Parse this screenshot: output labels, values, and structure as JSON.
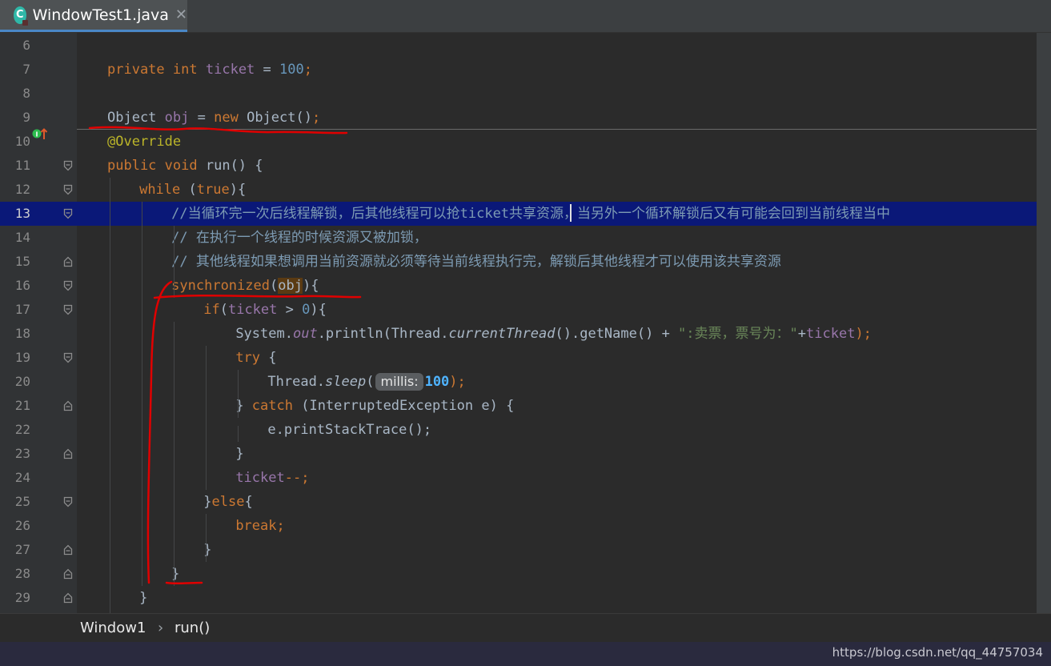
{
  "tab": {
    "file_name": "WindowTest1.java",
    "icon": "java-class-icon",
    "close_label": "✕"
  },
  "editor": {
    "current_line": 13,
    "lines": [
      {
        "n": "6"
      },
      {
        "n": "7"
      },
      {
        "n": "8"
      },
      {
        "n": "9"
      },
      {
        "n": "10"
      },
      {
        "n": "11"
      },
      {
        "n": "12"
      },
      {
        "n": "13"
      },
      {
        "n": "14"
      },
      {
        "n": "15"
      },
      {
        "n": "16"
      },
      {
        "n": "17"
      },
      {
        "n": "18"
      },
      {
        "n": "19"
      },
      {
        "n": "20"
      },
      {
        "n": "21"
      },
      {
        "n": "22"
      },
      {
        "n": "23"
      },
      {
        "n": "24"
      },
      {
        "n": "25"
      },
      {
        "n": "26"
      },
      {
        "n": "27"
      },
      {
        "n": "28"
      },
      {
        "n": "29"
      }
    ],
    "code": {
      "l7": {
        "kw1": "private",
        "kw2": "int",
        "field": "ticket",
        "op": " = ",
        "num": "100",
        "semi": ";"
      },
      "l9": {
        "type": "Object",
        "var": "obj",
        "op": " = ",
        "kw": "new",
        "ctor": "Object()",
        "semi": ";"
      },
      "l10": {
        "annotation": "@Override"
      },
      "l11": {
        "kw1": "public",
        "kw2": "void",
        "rest": " run() {"
      },
      "l12": {
        "kw": "while",
        "open": " (",
        "val": "true",
        "close": "){"
      },
      "l13": {
        "comment": "//当循环完一次后线程解锁，后其他线程可以抢ticket共享资源，当另外一个循环解锁后又有可能会回到当前线程当中"
      },
      "l14": {
        "comment": "// 在执行一个线程的时候资源又被加锁，"
      },
      "l15": {
        "comment": "// 其他线程如果想调用当前资源就必须等待当前线程执行完，解锁后其他线程才可以使用该共享资源"
      },
      "l16": {
        "kw": "synchronized",
        "open": "(",
        "obj": "obj",
        "close": "){"
      },
      "l17": {
        "kw": "if",
        "open": "(",
        "field": "ticket",
        "op": " > ",
        "num": "0",
        "close": "){"
      },
      "l18": {
        "p1": "System.",
        "out": "out",
        "p2": ".println(Thread.",
        "ct": "currentThread",
        "p3": "().getName() + ",
        "str": "\":卖票，票号为：\"",
        "plus": "+",
        "field": "ticket",
        "p4": ");"
      },
      "l19": {
        "kw": "try",
        "rest": " {"
      },
      "l20": {
        "p1": "Thread.",
        "sleep": "sleep",
        "p2": "(",
        "hint": "millis:",
        "num": "100",
        "p3": ");"
      },
      "l21": {
        "p1": "} ",
        "kw": "catch",
        "p2": " (InterruptedException e) {"
      },
      "l22": {
        "text": "e.printStackTrace();"
      },
      "l23": {
        "text": "}"
      },
      "l24": {
        "field": "ticket",
        "op": "--;"
      },
      "l25": {
        "p1": "}",
        "kw": "else",
        "p2": "{"
      },
      "l26": {
        "kw": "break",
        "semi": ";"
      },
      "l27": {
        "text": "}"
      },
      "l28": {
        "text": "}"
      },
      "l29": {
        "text": "}"
      }
    }
  },
  "breadcrumb": {
    "class_name": "Window1",
    "separator": "›",
    "method": "run()"
  },
  "watermark": "https://blog.csdn.net/qq_44757034",
  "colors": {
    "keyword": "#cc7832",
    "field": "#9876aa",
    "number": "#6897bb",
    "comment": "#808080",
    "string": "#6a8759",
    "annotation": "#bbb529",
    "current_line": "#0a1878",
    "ink": "#e00000"
  }
}
